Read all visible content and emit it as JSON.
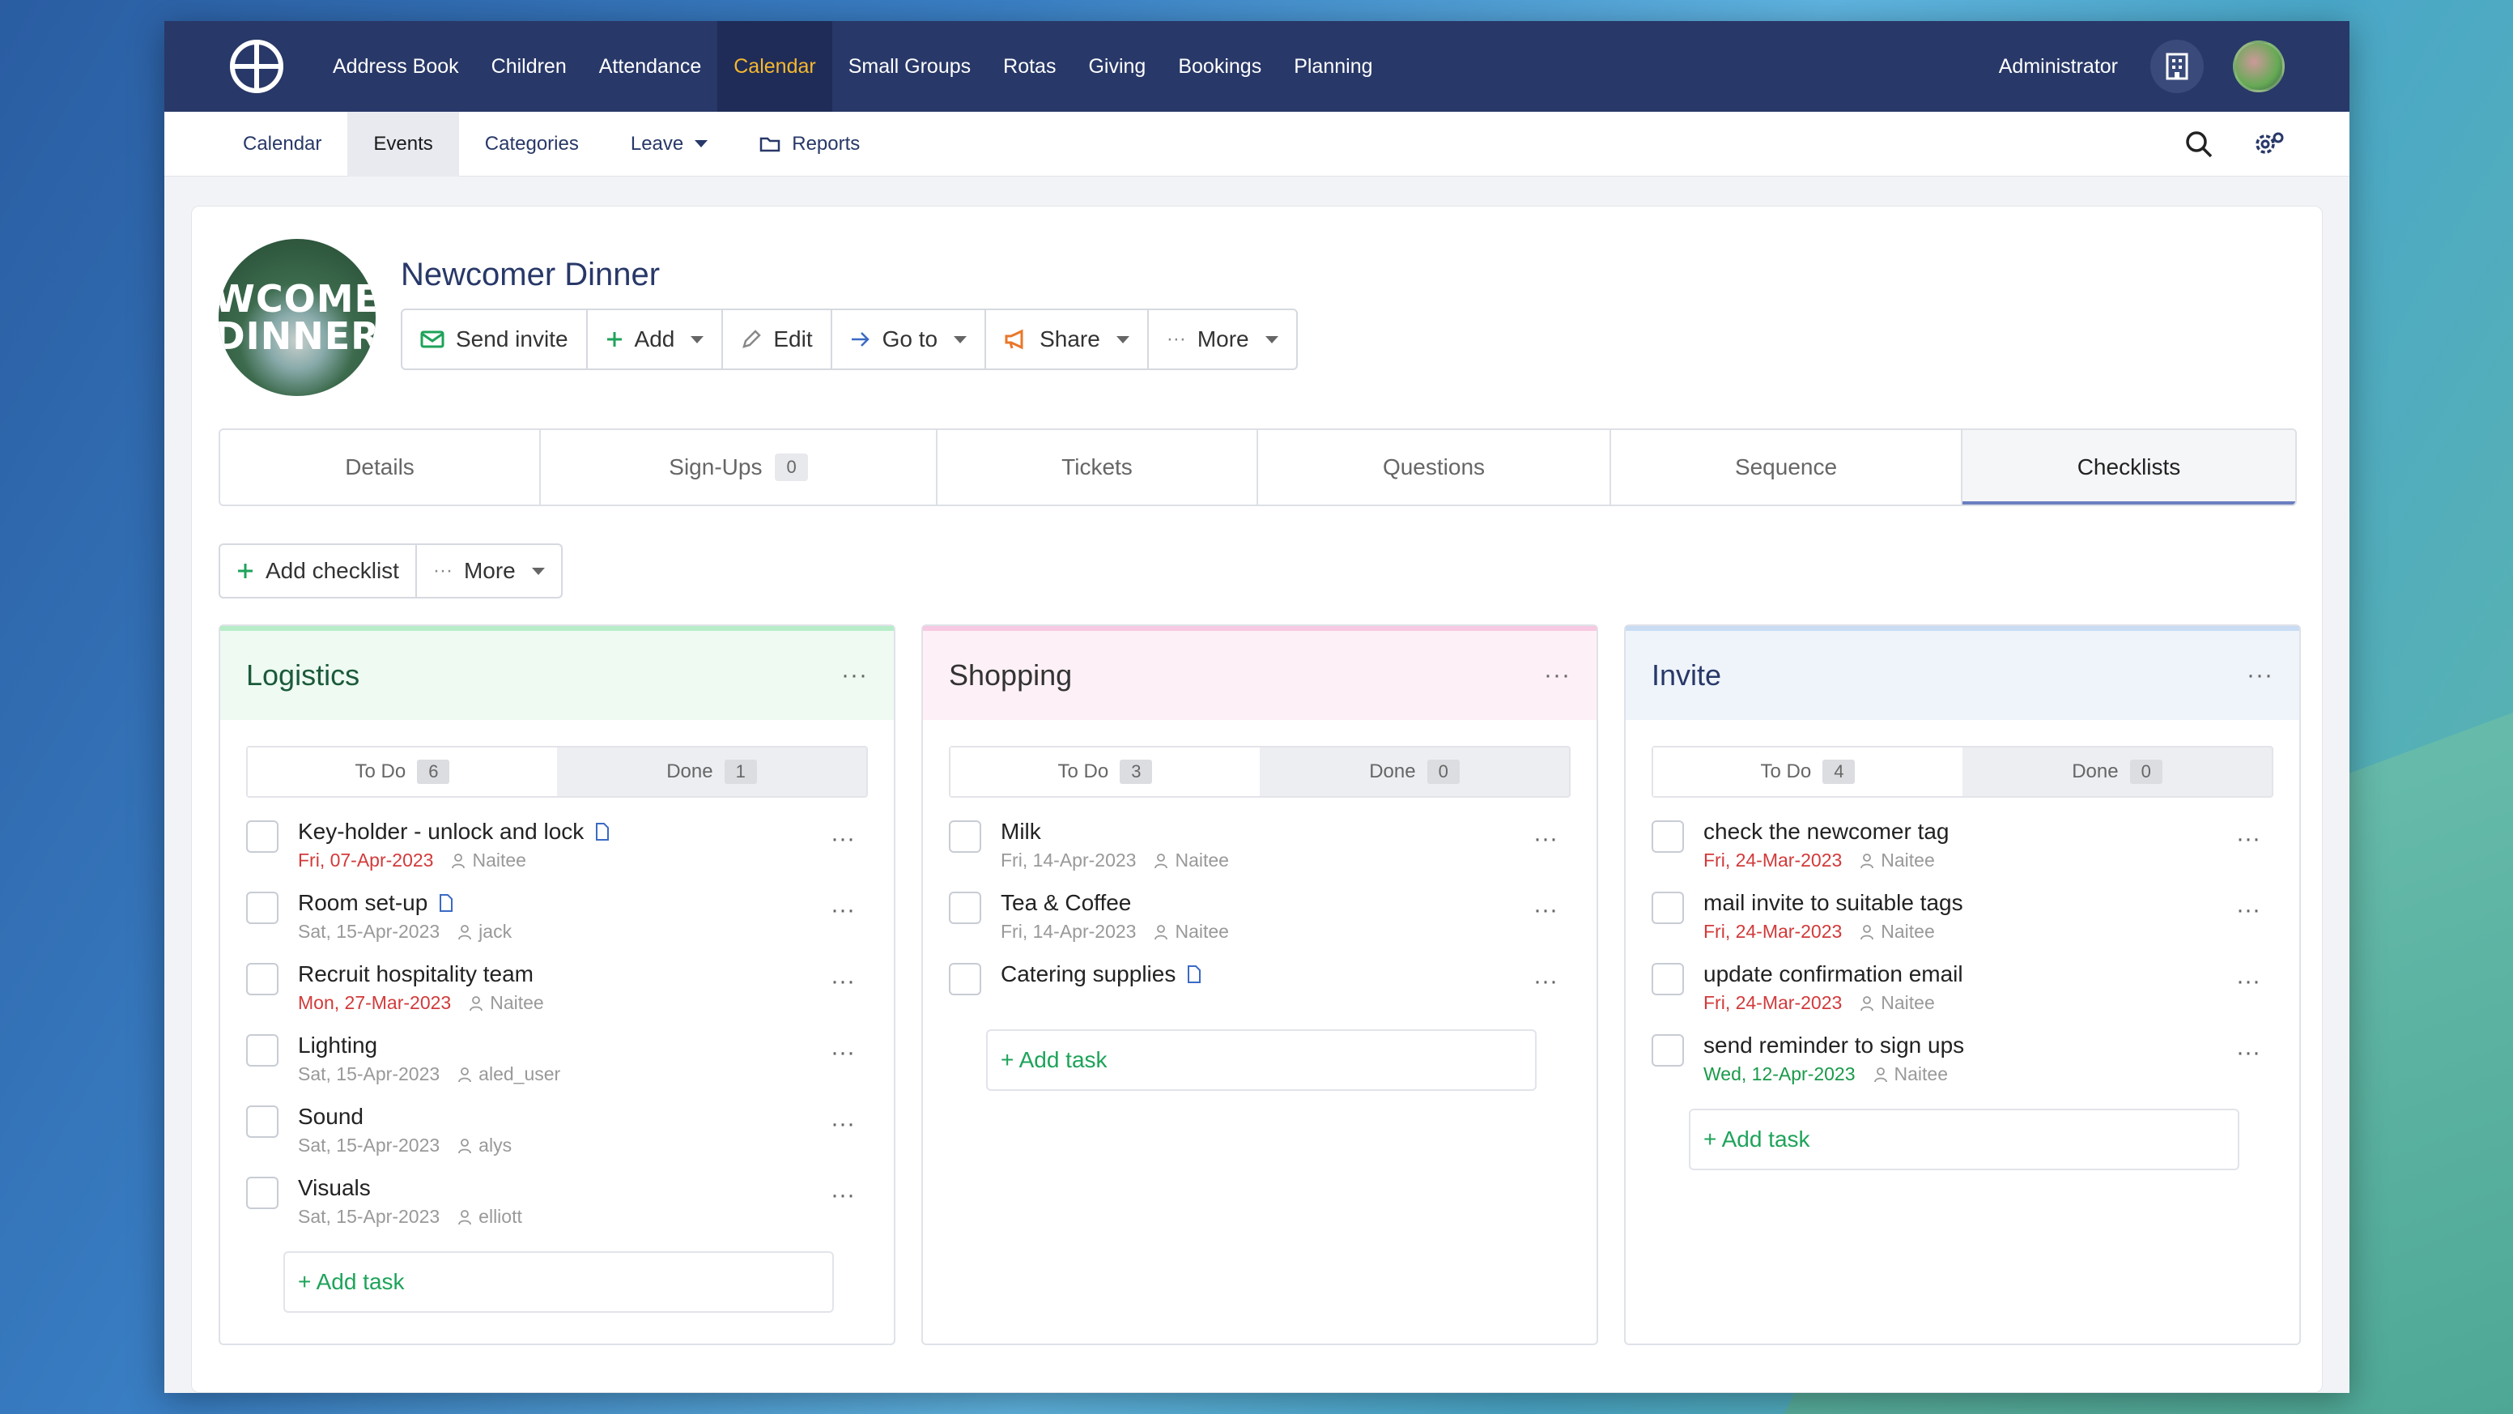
{
  "topnav": {
    "items": [
      "Address Book",
      "Children",
      "Attendance",
      "Calendar",
      "Small Groups",
      "Rotas",
      "Giving",
      "Bookings",
      "Planning"
    ],
    "active": "Calendar",
    "admin_label": "Administrator"
  },
  "subnav": {
    "items": [
      "Calendar",
      "Events",
      "Categories",
      "Leave",
      "Reports"
    ],
    "active": "Events"
  },
  "event": {
    "image_text": [
      "WCOME",
      "DINNER"
    ],
    "title": "Newcomer Dinner",
    "toolbar": {
      "send_invite": "Send invite",
      "add": "Add",
      "edit": "Edit",
      "goto": "Go to",
      "share": "Share",
      "more": "More"
    }
  },
  "tabs": {
    "details": "Details",
    "signups": "Sign-Ups",
    "signups_count": "0",
    "tickets": "Tickets",
    "questions": "Questions",
    "sequence": "Sequence",
    "checklists": "Checklists"
  },
  "actions": {
    "add_checklist": "Add checklist",
    "more": "More"
  },
  "checklists": [
    {
      "title": "Logistics",
      "todo_label": "To Do",
      "todo_count": "6",
      "done_label": "Done",
      "done_count": "1",
      "tasks": [
        {
          "name": "Key-holder - unlock and lock",
          "date": "Fri, 07-Apr-2023",
          "date_color": "red",
          "user": "Naitee",
          "doc": true
        },
        {
          "name": "Room set-up",
          "date": "Sat, 15-Apr-2023",
          "date_color": "grey",
          "user": "jack",
          "doc": true
        },
        {
          "name": "Recruit hospitality team",
          "date": "Mon, 27-Mar-2023",
          "date_color": "red",
          "user": "Naitee",
          "doc": false
        },
        {
          "name": "Lighting",
          "date": "Sat, 15-Apr-2023",
          "date_color": "grey",
          "user": "aled_user",
          "doc": false
        },
        {
          "name": "Sound",
          "date": "Sat, 15-Apr-2023",
          "date_color": "grey",
          "user": "alys",
          "doc": false
        },
        {
          "name": "Visuals",
          "date": "Sat, 15-Apr-2023",
          "date_color": "grey",
          "user": "elliott",
          "doc": false
        }
      ],
      "add_task": "+ Add task"
    },
    {
      "title": "Shopping",
      "todo_label": "To Do",
      "todo_count": "3",
      "done_label": "Done",
      "done_count": "0",
      "tasks": [
        {
          "name": "Milk",
          "date": "Fri, 14-Apr-2023",
          "date_color": "grey",
          "user": "Naitee",
          "doc": false
        },
        {
          "name": "Tea & Coffee",
          "date": "Fri, 14-Apr-2023",
          "date_color": "grey",
          "user": "Naitee",
          "doc": false
        },
        {
          "name": "Catering supplies",
          "date": "",
          "date_color": "grey",
          "user": "",
          "doc": true
        }
      ],
      "add_task": "+ Add task"
    },
    {
      "title": "Invite",
      "todo_label": "To Do",
      "todo_count": "4",
      "done_label": "Done",
      "done_count": "0",
      "tasks": [
        {
          "name": "check the newcomer tag",
          "date": "Fri, 24-Mar-2023",
          "date_color": "red",
          "user": "Naitee",
          "doc": false
        },
        {
          "name": "mail invite to suitable tags",
          "date": "Fri, 24-Mar-2023",
          "date_color": "red",
          "user": "Naitee",
          "doc": false
        },
        {
          "name": "update confirmation email",
          "date": "Fri, 24-Mar-2023",
          "date_color": "red",
          "user": "Naitee",
          "doc": false
        },
        {
          "name": "send reminder to sign ups",
          "date": "Wed, 12-Apr-2023",
          "date_color": "green",
          "user": "Naitee",
          "doc": false
        }
      ],
      "add_task": "+ Add task"
    }
  ],
  "colors": {
    "nav_bg": "#283868",
    "nav_active": "#f5b82e",
    "logistics_accent": "#b7ecc8",
    "shopping_accent": "#f7c9e2",
    "invite_accent": "#c9dcf3",
    "overdue": "#d23a3a",
    "upcoming": "#1a9a4a",
    "add_green": "#1ea35a"
  }
}
